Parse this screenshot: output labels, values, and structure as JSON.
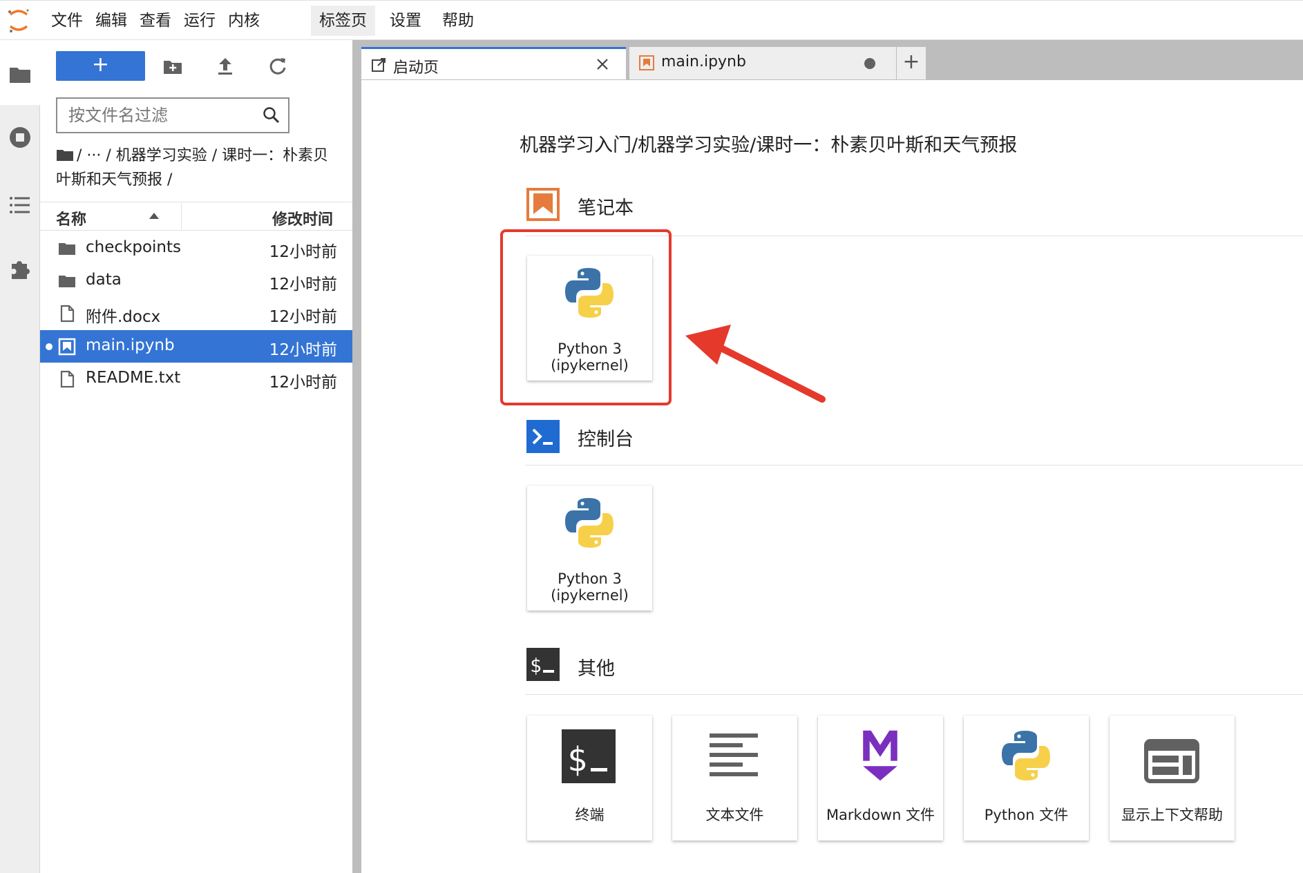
{
  "menu": {
    "items": [
      "文件",
      "编辑",
      "查看",
      "运行",
      "内核",
      "标签页",
      "设置",
      "帮助"
    ],
    "active_index": 5
  },
  "file_browser": {
    "new_button_label": "+",
    "filter_placeholder": "按文件名过滤",
    "breadcrumb": "/ ··· / 机器学习实验 / 课时一：朴素贝叶斯和天气预报 /",
    "columns": {
      "name": "名称",
      "modified": "修改时间"
    },
    "files": [
      {
        "name": "checkpoints",
        "modified": "12小时前",
        "kind": "folder",
        "selected": false
      },
      {
        "name": "data",
        "modified": "12小时前",
        "kind": "folder",
        "selected": false
      },
      {
        "name": "附件.docx",
        "modified": "12小时前",
        "kind": "file",
        "selected": false
      },
      {
        "name": "main.ipynb",
        "modified": "12小时前",
        "kind": "notebook",
        "selected": true
      },
      {
        "name": "README.txt",
        "modified": "12小时前",
        "kind": "file",
        "selected": false
      }
    ]
  },
  "tabs": [
    {
      "label": "启动页",
      "icon": "launcher-icon",
      "active": true
    },
    {
      "label": "main.ipynb",
      "icon": "notebook-icon",
      "active": false,
      "dirty": true
    }
  ],
  "launcher": {
    "path": "机器学习入门/机器学习实验/课时一：朴素贝叶斯和天气预报",
    "sections": {
      "notebook": {
        "title": "笔记本",
        "cards": [
          {
            "label_line1": "Python 3",
            "label_line2": "(ipykernel)"
          }
        ]
      },
      "console": {
        "title": "控制台",
        "cards": [
          {
            "label_line1": "Python 3",
            "label_line2": "(ipykernel)"
          }
        ]
      },
      "other": {
        "title": "其他",
        "cards": [
          {
            "label": "终端",
            "icon": "terminal-icon"
          },
          {
            "label": "文本文件",
            "icon": "text-file-icon"
          },
          {
            "label": "Markdown 文件",
            "icon": "markdown-icon"
          },
          {
            "label": "Python 文件",
            "icon": "python-icon"
          },
          {
            "label": "显示上下文帮助",
            "icon": "context-help-icon"
          }
        ]
      }
    }
  },
  "colors": {
    "accent": "#3474d4",
    "annotation": "#e5392b",
    "notebook_orange": "#e57b3d",
    "markdown_purple": "#7b2fbe"
  }
}
